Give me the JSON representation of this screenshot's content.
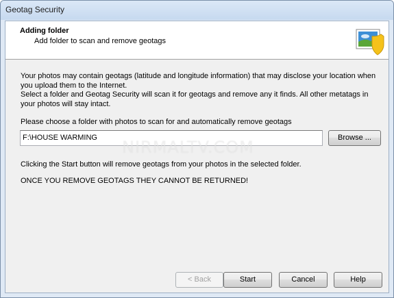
{
  "window": {
    "title": "Geotag Security"
  },
  "header": {
    "title": "Adding folder",
    "subtitle": "Add folder to scan and remove geotags",
    "icon": "photo-shield-icon"
  },
  "body": {
    "para1": "Your photos may contain geotags (latitude and longitude information) that may disclose your location when you upload them to the Internet.",
    "para2": "Select a folder and Geotag Security will scan it for geotags and remove any it finds. All other metatags in your photos will stay intact.",
    "choose_label": "Please choose a folder with photos to scan for and automatically remove geotags",
    "folder_value": "F:\\HOUSE WARMING",
    "browse_label": "Browse ...",
    "start_note": "Clicking the Start button will remove geotags from your photos in the selected folder.",
    "warning": "ONCE YOU REMOVE GEOTAGS THEY CANNOT BE RETURNED!"
  },
  "watermark": "NIRMALTV.COM",
  "footer": {
    "back_label": "< Back",
    "start_label": "Start",
    "cancel_label": "Cancel",
    "help_label": "Help"
  },
  "colors": {
    "shield": "#f5c21b",
    "sky": "#3d8fd6",
    "grass": "#5aa638"
  }
}
